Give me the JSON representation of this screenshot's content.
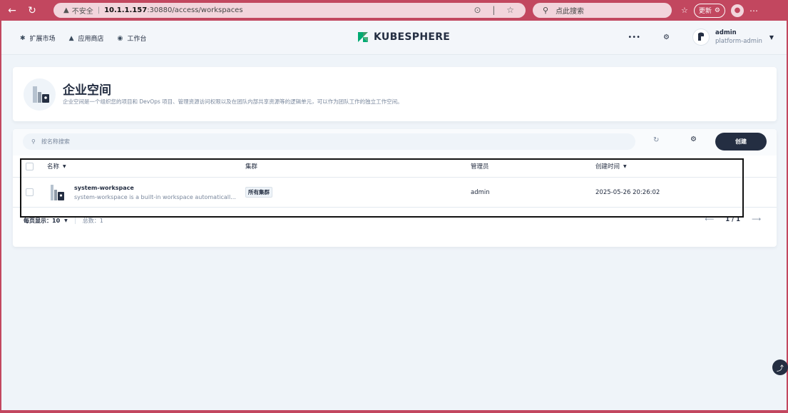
{
  "browser": {
    "insecure_label": "不安全",
    "url_host": "10.1.1.157",
    "url_path": ":30880/access/workspaces",
    "search_placeholder": "点此搜索",
    "update_label": "更新"
  },
  "topnav": {
    "items": [
      {
        "label": "扩展市场"
      },
      {
        "label": "应用商店"
      },
      {
        "label": "工作台"
      }
    ],
    "logo_text": "KUBESPHERE",
    "user_name": "admin",
    "user_role": "platform-admin"
  },
  "banner": {
    "title": "企业空间",
    "description": "企业空间是一个组织您的项目和 DevOps 项目、管理资源访问权限以及在团队内部共享资源等的逻辑单元，可以作为团队工作的独立工作空间。"
  },
  "toolbar": {
    "search_placeholder": "按名称搜索",
    "create_label": "创建"
  },
  "table": {
    "columns": [
      "名称",
      "集群",
      "管理员",
      "创建时间"
    ],
    "rows": [
      {
        "name": "system-workspace",
        "description": "system-workspace is a built-in workspace automaticall...",
        "cluster": "所有集群",
        "manager": "admin",
        "created": "2025-05-26 20:26:02"
      }
    ]
  },
  "pagination": {
    "per_page_label": "每页显示：",
    "per_page_value": "10",
    "total_label": "总数：",
    "total_value": "1",
    "page": "1 / 1"
  },
  "colors": {
    "accent": "#242e42",
    "browser_chrome": "#c2475f",
    "logo_green": "#00aa72"
  }
}
